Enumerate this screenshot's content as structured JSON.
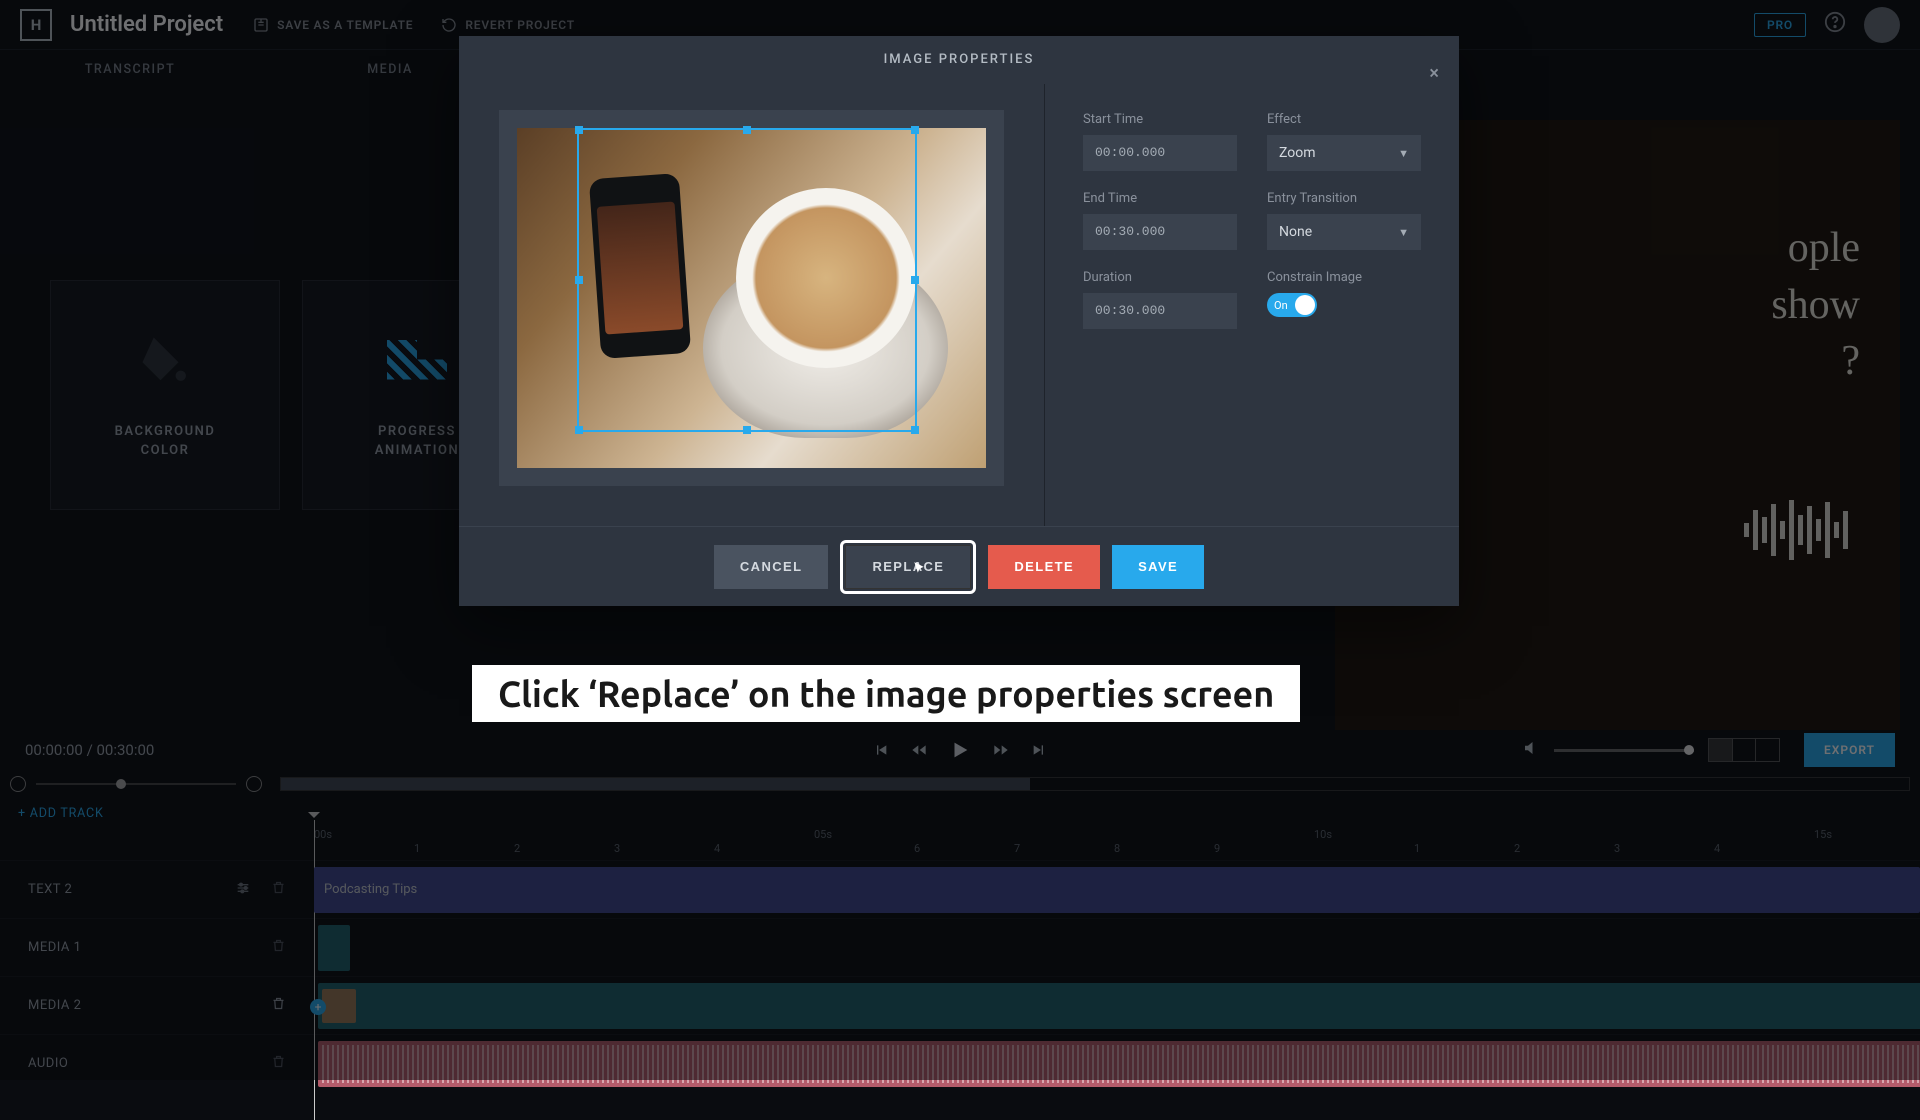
{
  "topbar": {
    "logo": "H",
    "project_title": "Untitled Project",
    "save_template": "SAVE AS A TEMPLATE",
    "revert": "REVERT PROJECT",
    "pro": "PRO"
  },
  "left_tabs": {
    "t1": "TRANSCRIPT",
    "t2": "MEDIA"
  },
  "tiles": {
    "bg": "BACKGROUND\nCOLOR",
    "prog": "PROGRESS\nANIMATION"
  },
  "preview": {
    "text": "ople\nshow\n?"
  },
  "playbar": {
    "time": "00:00:00 / 00:30:00",
    "export": "EXPORT"
  },
  "timeline": {
    "add_track": "+ ADD TRACK",
    "ruler": [
      "00s",
      "05s",
      "10s",
      "15s"
    ],
    "lnums": [
      "0",
      "1",
      "2",
      "3",
      "4",
      "5",
      "6",
      "7",
      "8",
      "9",
      "0",
      "1",
      "2",
      "3",
      "4",
      "5"
    ],
    "tracks": {
      "text2": "TEXT 2",
      "media1": "MEDIA 1",
      "media2": "MEDIA 2",
      "audio": "AUDIO"
    },
    "clip_text_label": "Podcasting Tips"
  },
  "modal": {
    "title": "IMAGE PROPERTIES",
    "labels": {
      "start": "Start Time",
      "end": "End Time",
      "duration": "Duration",
      "effect": "Effect",
      "entry": "Entry Transition",
      "constrain": "Constrain Image"
    },
    "values": {
      "start": "00:00.000",
      "end": "00:30.000",
      "duration": "00:30.000",
      "effect": "Zoom",
      "entry": "None",
      "toggle": "On"
    },
    "buttons": {
      "cancel": "CANCEL",
      "replace": "REPLACE",
      "delete": "DELETE",
      "save": "SAVE"
    }
  },
  "callout": "Click ‘Replace’ on the image properties screen"
}
